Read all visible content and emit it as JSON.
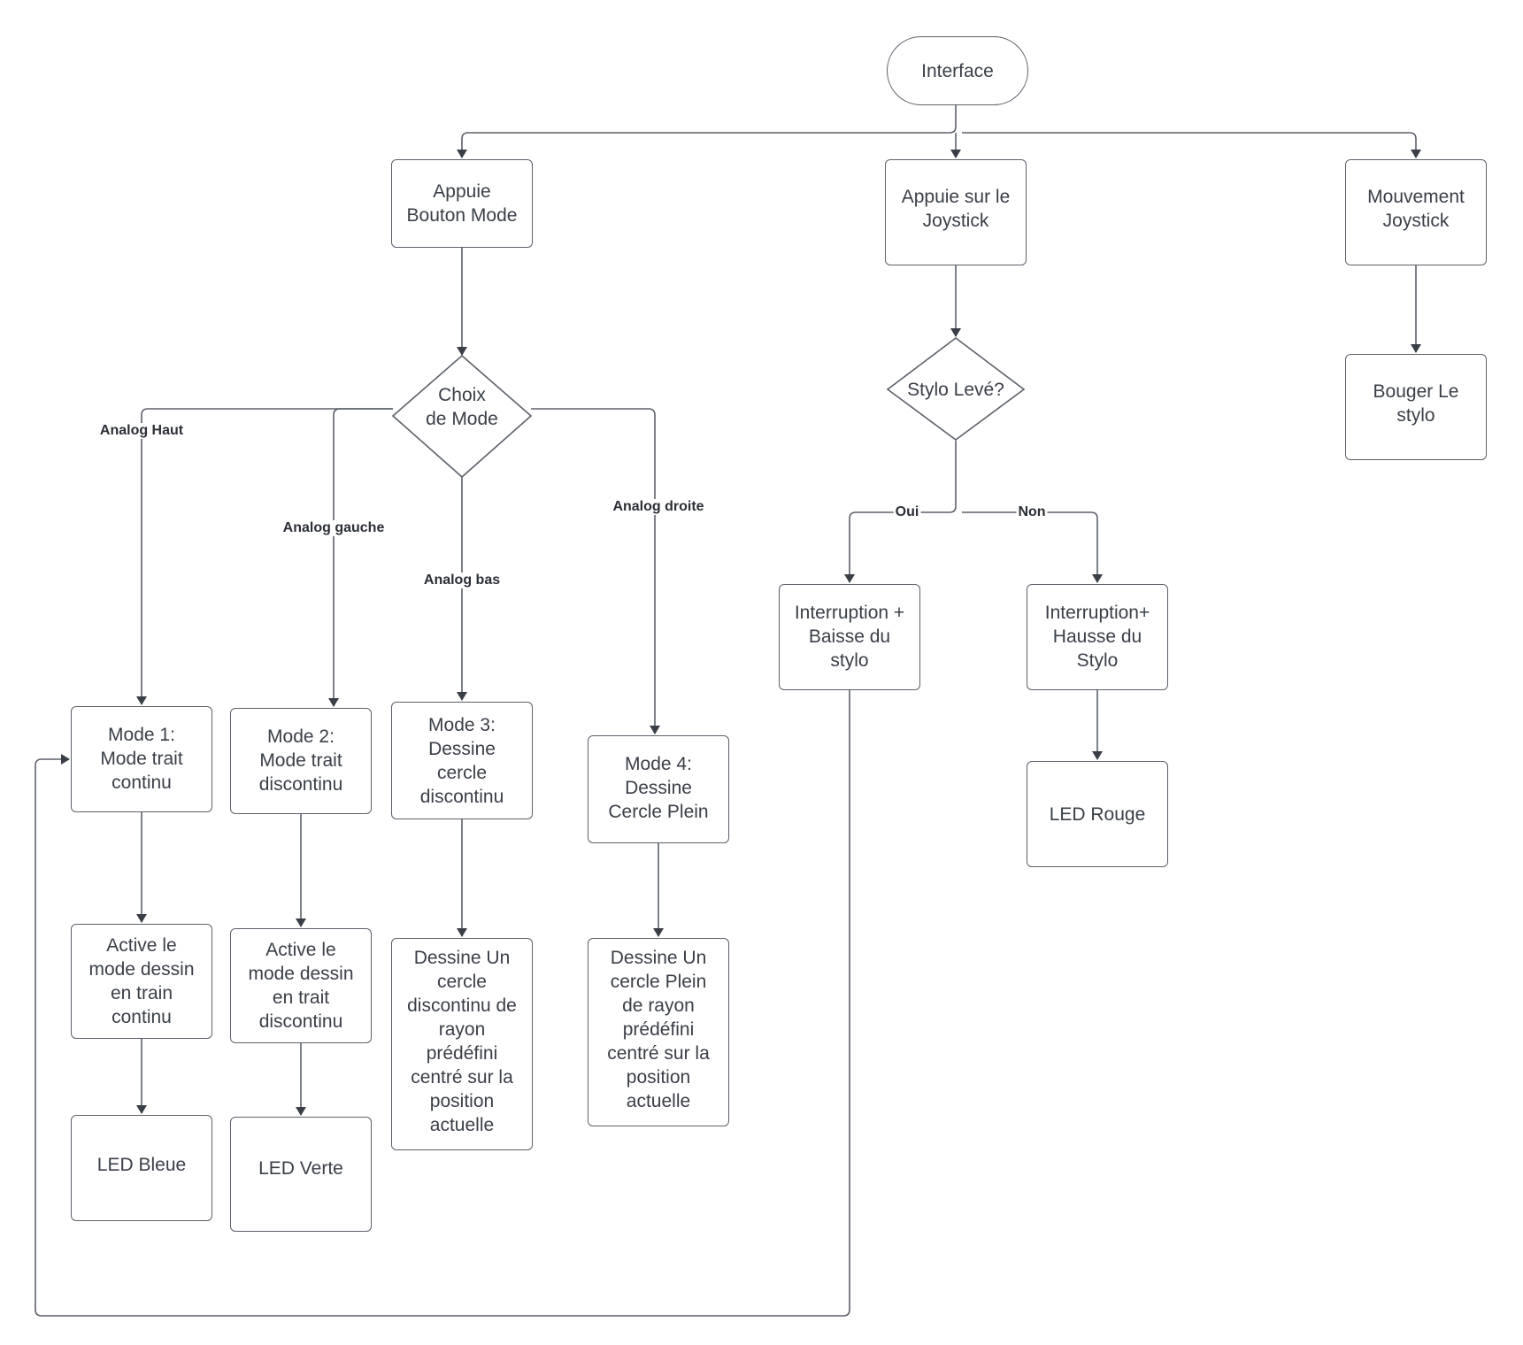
{
  "diagram": {
    "type": "flowchart",
    "nodes": {
      "interface": "Interface",
      "appuie_bouton_mode": "Appuie\nBouton Mode",
      "appuie_joystick": "Appuie sur le\nJoystick",
      "mouvement_joystick": "Mouvement\nJoystick",
      "bouger_stylo": "Bouger Le\nstylo",
      "choix_mode": "Choix\nde Mode",
      "stylo_leve": "Stylo Levé?",
      "interruption_baisse": "Interruption +\nBaisse du\nstylo",
      "interruption_hausse": "Interruption+\nHausse du\nStylo",
      "led_rouge": "LED Rouge",
      "mode1": "Mode 1:\nMode trait\ncontinu",
      "mode2": "Mode 2:\nMode trait\ndiscontinu",
      "mode3": "Mode 3:\nDessine\ncercle\ndiscontinu",
      "mode4": "Mode 4:\nDessine\nCercle Plein",
      "active1": "Active le\nmode dessin\nen train\ncontinu",
      "active2": "Active le\nmode dessin\nen trait\ndiscontinu",
      "dessine3": "Dessine Un\ncercle\ndiscontinu de\nrayon\nprédéfini\ncentré sur la\nposition\nactuelle",
      "dessine4": "Dessine Un\ncercle Plein\nde rayon\nprédéfini\ncentré sur la\nposition\nactuelle",
      "led_bleue": "LED Bleue",
      "led_verte": "LED Verte"
    },
    "edge_labels": {
      "analog_haut": "Analog Haut",
      "analog_gauche": "Analog gauche",
      "analog_bas": "Analog bas",
      "analog_droite": "Analog droite",
      "oui": "Oui",
      "non": "Non"
    },
    "edges": [
      {
        "from": "interface",
        "to": "appuie_bouton_mode"
      },
      {
        "from": "interface",
        "to": "appuie_joystick"
      },
      {
        "from": "interface",
        "to": "mouvement_joystick"
      },
      {
        "from": "appuie_bouton_mode",
        "to": "choix_mode"
      },
      {
        "from": "choix_mode",
        "to": "mode1",
        "label": "Analog Haut"
      },
      {
        "from": "choix_mode",
        "to": "mode2",
        "label": "Analog gauche"
      },
      {
        "from": "choix_mode",
        "to": "mode3",
        "label": "Analog bas"
      },
      {
        "from": "choix_mode",
        "to": "mode4",
        "label": "Analog droite"
      },
      {
        "from": "mode1",
        "to": "active1"
      },
      {
        "from": "active1",
        "to": "led_bleue"
      },
      {
        "from": "mode2",
        "to": "active2"
      },
      {
        "from": "active2",
        "to": "led_verte"
      },
      {
        "from": "mode3",
        "to": "dessine3"
      },
      {
        "from": "mode4",
        "to": "dessine4"
      },
      {
        "from": "appuie_joystick",
        "to": "stylo_leve"
      },
      {
        "from": "stylo_leve",
        "to": "interruption_baisse",
        "label": "Oui"
      },
      {
        "from": "stylo_leve",
        "to": "interruption_hausse",
        "label": "Non"
      },
      {
        "from": "interruption_hausse",
        "to": "led_rouge"
      },
      {
        "from": "interruption_baisse",
        "to": "mode1"
      },
      {
        "from": "mouvement_joystick",
        "to": "bouger_stylo"
      }
    ],
    "colors": {
      "stroke": "#5c6069",
      "arrow": "#3a3f47",
      "text": "#3a3f47",
      "background": "#ffffff"
    }
  }
}
